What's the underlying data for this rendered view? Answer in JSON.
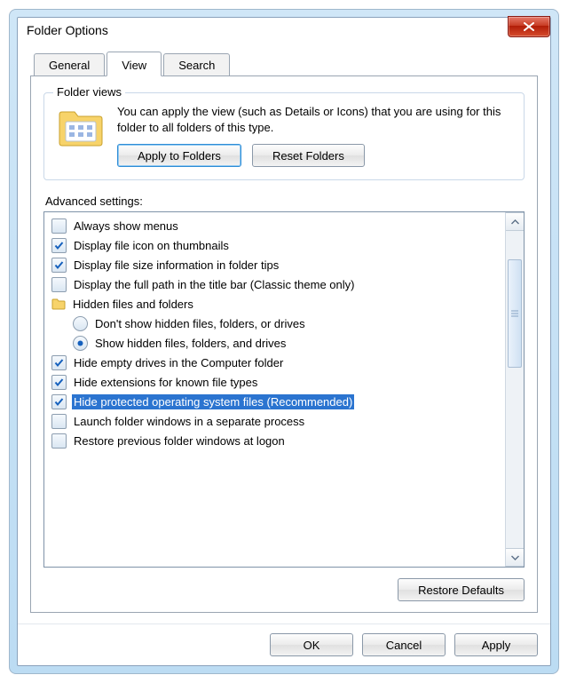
{
  "window": {
    "title": "Folder Options"
  },
  "tabs": {
    "general": "General",
    "view": "View",
    "search": "Search",
    "active": "view"
  },
  "folder_views": {
    "legend": "Folder views",
    "description": "You can apply the view (such as Details or Icons) that you are using for this folder to all folders of this type.",
    "apply": "Apply to Folders",
    "reset": "Reset Folders"
  },
  "advanced": {
    "label": "Advanced settings:",
    "items": [
      {
        "id": "always-show-menus",
        "type": "check",
        "checked": false,
        "indent": 0,
        "label": "Always show menus"
      },
      {
        "id": "display-file-icon",
        "type": "check",
        "checked": true,
        "indent": 0,
        "label": "Display file icon on thumbnails"
      },
      {
        "id": "display-file-size",
        "type": "check",
        "checked": true,
        "indent": 0,
        "label": "Display file size information in folder tips"
      },
      {
        "id": "display-full-path",
        "type": "check",
        "checked": false,
        "indent": 0,
        "label": "Display the full path in the title bar (Classic theme only)"
      },
      {
        "id": "hidden-header",
        "type": "header",
        "indent": 0,
        "label": "Hidden files and folders"
      },
      {
        "id": "dont-show-hidden",
        "type": "radio",
        "checked": false,
        "indent": 1,
        "label": "Don't show hidden files, folders, or drives"
      },
      {
        "id": "show-hidden",
        "type": "radio",
        "checked": true,
        "indent": 1,
        "label": "Show hidden files, folders, and drives"
      },
      {
        "id": "hide-empty-drives",
        "type": "check",
        "checked": true,
        "indent": 0,
        "label": "Hide empty drives in the Computer folder"
      },
      {
        "id": "hide-extensions",
        "type": "check",
        "checked": true,
        "indent": 0,
        "label": "Hide extensions for known file types"
      },
      {
        "id": "hide-protected",
        "type": "check",
        "checked": true,
        "indent": 0,
        "selected": true,
        "label": "Hide protected operating system files (Recommended)"
      },
      {
        "id": "launch-separate",
        "type": "check",
        "checked": false,
        "indent": 0,
        "label": "Launch folder windows in a separate process"
      },
      {
        "id": "restore-previous",
        "type": "check",
        "checked": false,
        "indent": 0,
        "label": "Restore previous folder windows at logon"
      }
    ]
  },
  "buttons": {
    "restore": "Restore Defaults",
    "ok": "OK",
    "cancel": "Cancel",
    "apply": "Apply"
  }
}
